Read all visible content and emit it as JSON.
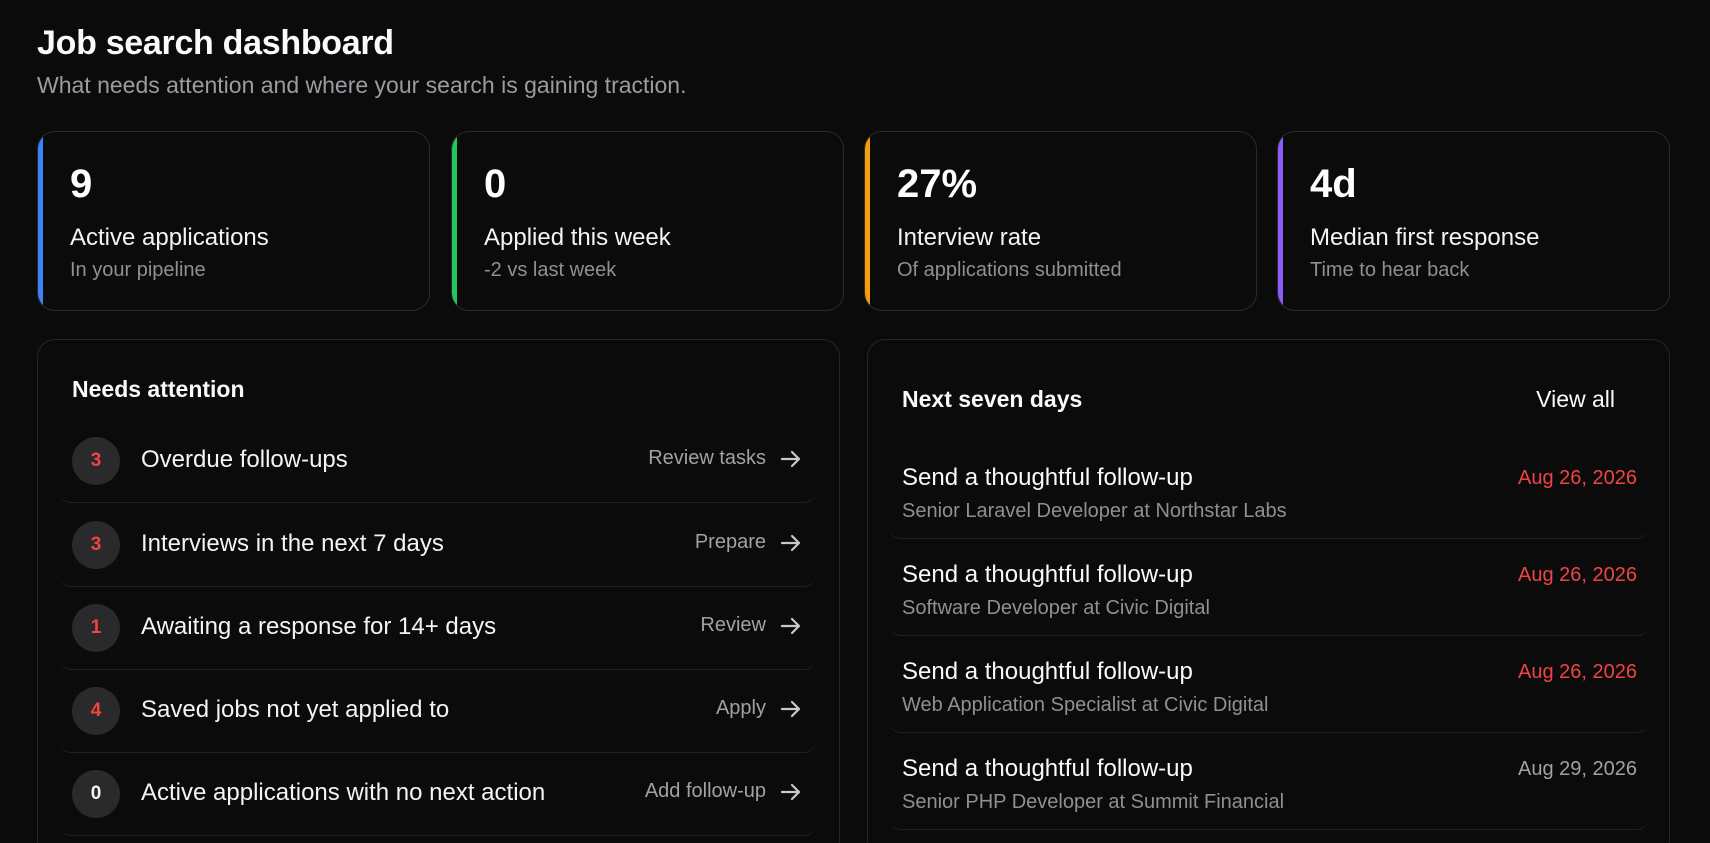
{
  "header": {
    "title": "Job search dashboard",
    "subtitle": "What needs attention and where your search is gaining traction."
  },
  "stats": [
    {
      "value": "9",
      "label": "Active applications",
      "sub": "In your pipeline",
      "accent": "#3b82f6"
    },
    {
      "value": "0",
      "label": "Applied this week",
      "sub": "-2 vs last week",
      "accent": "#22c55e"
    },
    {
      "value": "27%",
      "label": "Interview rate",
      "sub": "Of applications submitted",
      "accent": "#f59e0b"
    },
    {
      "value": "4d",
      "label": "Median first response",
      "sub": "Time to hear back",
      "accent": "#8b5cf6"
    }
  ],
  "attention": {
    "heading": "Needs attention",
    "items": [
      {
        "count": "3",
        "label": "Overdue follow-ups",
        "action": "Review tasks"
      },
      {
        "count": "3",
        "label": "Interviews in the next 7 days",
        "action": "Prepare"
      },
      {
        "count": "1",
        "label": "Awaiting a response for 14+ days",
        "action": "Review"
      },
      {
        "count": "4",
        "label": "Saved jobs not yet applied to",
        "action": "Apply"
      },
      {
        "count": "0",
        "label": "Active applications with no next action",
        "action": "Add follow-up"
      }
    ]
  },
  "upcoming": {
    "heading": "Next seven days",
    "view_all": "View all",
    "items": [
      {
        "title": "Send a thoughtful follow-up",
        "subtitle": "Senior Laravel Developer at Northstar Labs",
        "date": "Aug 26, 2026",
        "overdue": true
      },
      {
        "title": "Send a thoughtful follow-up",
        "subtitle": "Software Developer at Civic Digital",
        "date": "Aug 26, 2026",
        "overdue": true
      },
      {
        "title": "Send a thoughtful follow-up",
        "subtitle": "Web Application Specialist at Civic Digital",
        "date": "Aug 26, 2026",
        "overdue": true
      },
      {
        "title": "Send a thoughtful follow-up",
        "subtitle": "Senior PHP Developer at Summit Financial",
        "date": "Aug 29, 2026",
        "overdue": false
      }
    ]
  },
  "colors": {
    "background": "#0b0b0b",
    "overdue": "#ef4444",
    "muted": "#8f8f96"
  }
}
